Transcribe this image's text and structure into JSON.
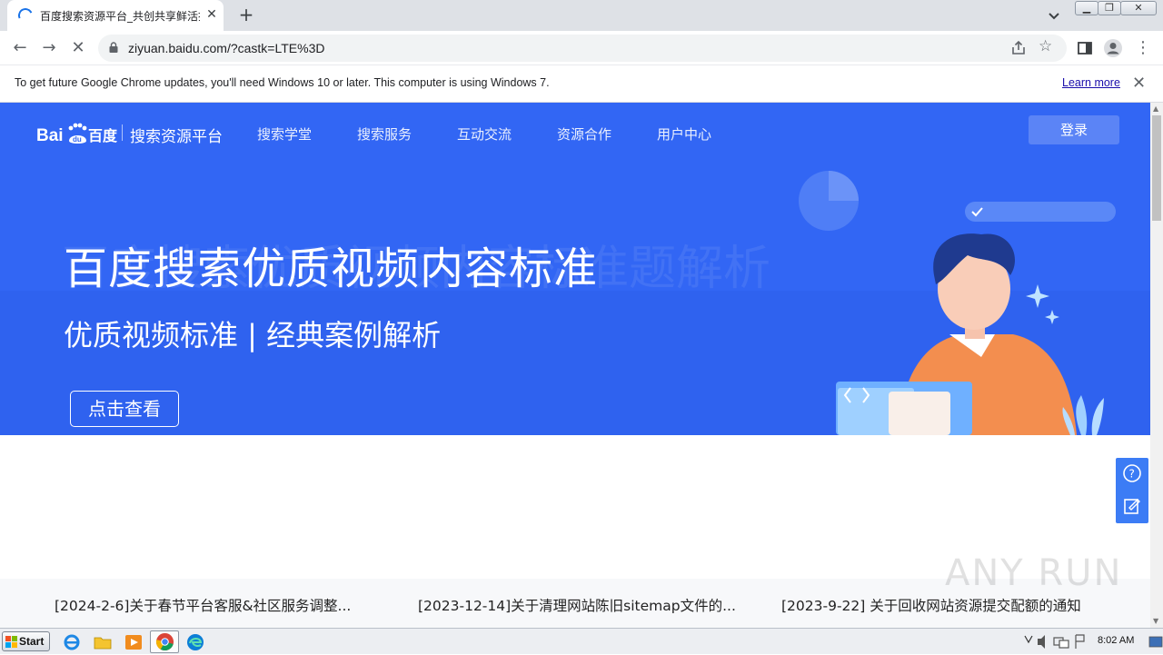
{
  "browser": {
    "tab_title": "百度搜索资源平台_共创共享鲜活搜索",
    "url": "ziyuan.baidu.com/?castk=LTE%3D",
    "info_bar": {
      "message": "To get future Google Chrome updates, you'll need Windows 10 or later. This computer is using Windows 7.",
      "link": "Learn more"
    }
  },
  "page": {
    "nav": {
      "platform": "搜索资源平台",
      "items": [
        "搜索学堂",
        "搜索服务",
        "互动交流",
        "资源合作",
        "用户中心"
      ],
      "login": "登录"
    },
    "hero": {
      "ghost_title": "百度搜索优质视频内容标准题解析",
      "title": "百度搜索优质视频内容标准",
      "subtitle": "优质视频标准 | 经典案例解析",
      "cta": "点击查看"
    },
    "news": [
      "[2024-2-6]关于春节平台客服&社区服务调整...",
      "[2023-12-14]关于清理网站陈旧sitemap文件的...",
      "[2023-9-22] 关于回收网站资源提交配额的通知"
    ],
    "watermark": "ANY RUN"
  },
  "taskbar": {
    "start": "Start",
    "clock": "8:02 AM"
  },
  "colors": {
    "hero_blue": "#3266f4",
    "chrome_frame": "#dee1e6"
  }
}
